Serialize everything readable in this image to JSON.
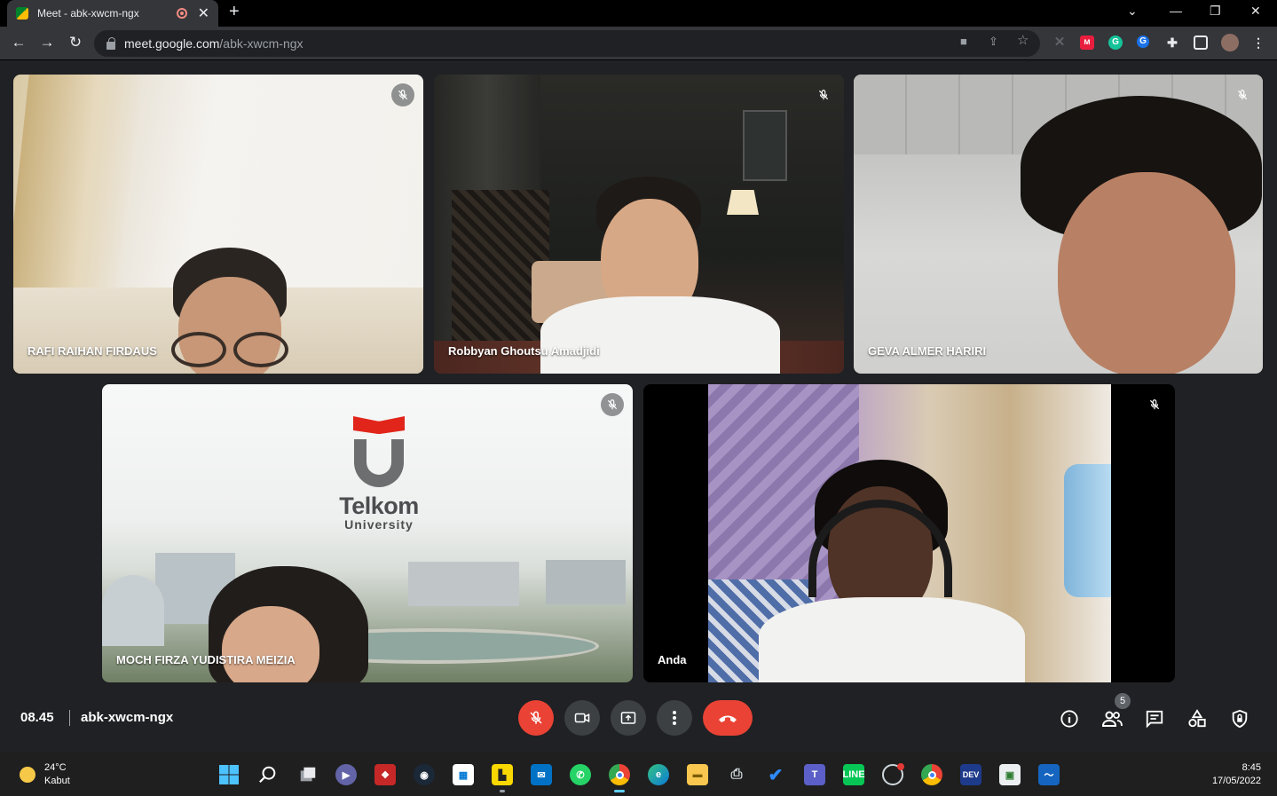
{
  "browser": {
    "tab_title": "Meet - abk-xwcm-ngx",
    "tab_close": "✕",
    "new_tab": "+",
    "url_host": "meet.google.com",
    "url_path": "/abk-xwcm-ngx",
    "window_controls": [
      "⌄",
      "—",
      "❐",
      "✕"
    ]
  },
  "participants": [
    {
      "name": "RAFI RAIHAN FIRDAUS",
      "muted": true
    },
    {
      "name": "Robbyan Ghoutsu Amadjidi",
      "muted": true
    },
    {
      "name": "GEVA ALMER HARIRI",
      "muted": true
    },
    {
      "name": "MOCH FIRZA YUDISTIRA MEIZIA",
      "muted": true
    },
    {
      "name": "Anda",
      "muted": true
    }
  ],
  "background_logo": {
    "line1": "Telkom",
    "line2": "University"
  },
  "meeting": {
    "time": "08.45",
    "code": "abk-xwcm-ngx",
    "participant_count": "5"
  },
  "taskbar": {
    "weather_temp": "24°C",
    "weather_desc": "Kabut",
    "clock_time": "8:45",
    "clock_date": "17/05/2022",
    "dev_label": "DEV"
  },
  "colors": {
    "meet_bg": "#202124",
    "mic_off_red": "#ea4335",
    "telkom_red": "#e1251b"
  }
}
